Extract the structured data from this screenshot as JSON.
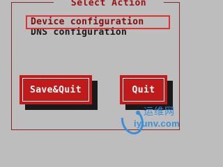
{
  "dialog": {
    "title": "Select Action",
    "items": [
      {
        "label": "Device configuration",
        "selected": true
      },
      {
        "label": "DNS configuration",
        "selected": false
      }
    ]
  },
  "buttons": {
    "save_quit": "Save&Quit",
    "quit": "Quit"
  },
  "watermark": {
    "top": "运维网",
    "bottom": "iyunv.com"
  },
  "colors": {
    "background": "#bdbdbd",
    "frame": "#8a2424",
    "button": "#bf1b1b",
    "selection_outline": "#e03030",
    "watermark": "#3a8fd9"
  }
}
